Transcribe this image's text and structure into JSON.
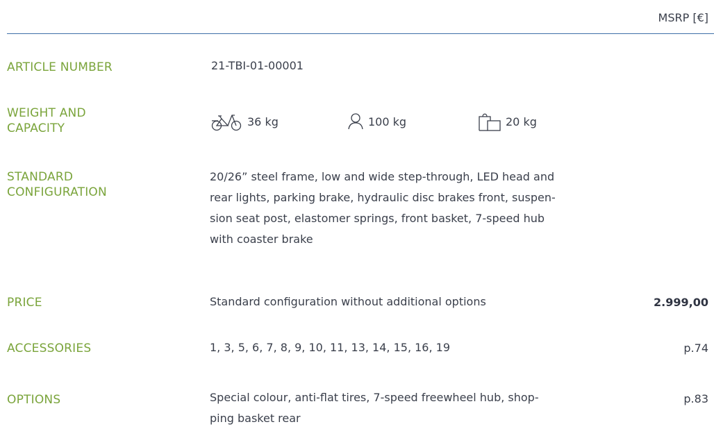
{
  "header": {
    "msrp": "MSRP [€]"
  },
  "article": {
    "label": "ARTICLE NUMBER",
    "value": "21-TBI-01-00001"
  },
  "weight": {
    "label_line1": "WEIGHT AND",
    "label_line2": "CAPACITY",
    "bike_weight": "36 kg",
    "rider_capacity": "100 kg",
    "cargo_capacity": "20 kg",
    "icons": [
      "bicycle-icon",
      "person-icon",
      "shopping-bag-icon"
    ]
  },
  "standard": {
    "label_line1": "STANDARD",
    "label_line2": "CONFIGURATION",
    "lines": [
      "20/26” steel frame, low and wide step-through, LED head and",
      "rear lights, parking brake, hydraulic disc brakes front, suspen-",
      "sion seat post, elastomer springs, front basket, 7-speed hub",
      "with coaster brake"
    ]
  },
  "price": {
    "label": "PRICE",
    "description": "Standard configuration without additional options",
    "value": "2.999,00"
  },
  "accessories": {
    "label": "ACCESSORIES",
    "value": "1, 3, 5, 6, 7, 8, 9, 10, 11, 13, 14, 15, 16, 19",
    "page": "p.74"
  },
  "options": {
    "label": "OPTIONS",
    "lines": [
      "Special colour, anti-flat tires, 7-speed freewheel hub, shop-",
      "ping basket rear"
    ],
    "page": "p.83"
  },
  "colors": {
    "label_green": "#7aa43b",
    "rule_blue": "#3d6fa8",
    "text": "#3a3f4b"
  }
}
